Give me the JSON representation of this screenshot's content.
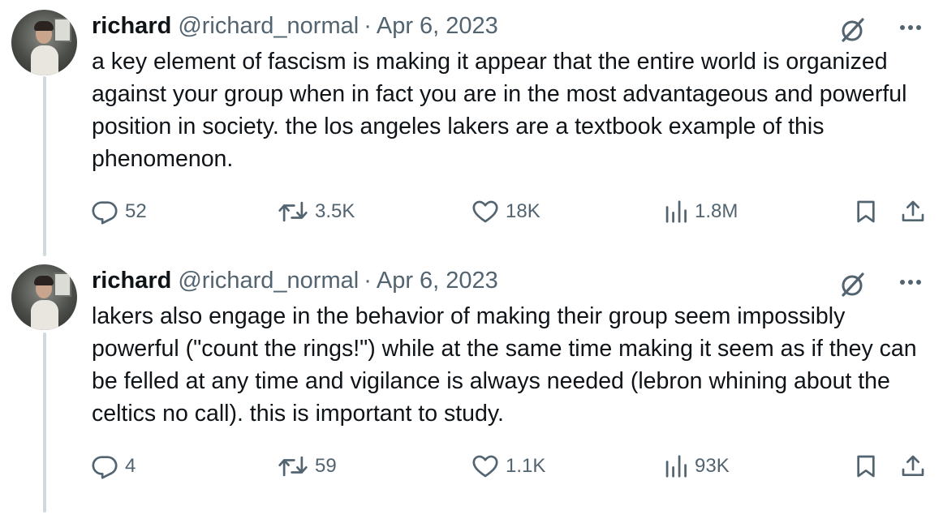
{
  "tweets": [
    {
      "author_name": "richard",
      "handle": "@richard_normal",
      "separator": "·",
      "date": "Apr 6, 2023",
      "text": "a key element of fascism is making it appear that the entire world is organized against your group when in fact you are in the most advantageous and powerful position in society. the los angeles lakers are a textbook example of this phenomenon.",
      "replies": "52",
      "reposts": "3.5K",
      "likes": "18K",
      "views": "1.8M"
    },
    {
      "author_name": "richard",
      "handle": "@richard_normal",
      "separator": "·",
      "date": "Apr 6, 2023",
      "text": "lakers also engage in the behavior of making their group seem impossibly powerful (\"count the rings!\") while at the same time making it seem as if they can be felled at any time and vigilance is always needed (lebron whining about the celtics no call). this is important to study.",
      "replies": "4",
      "reposts": "59",
      "likes": "1.1K",
      "views": "93K"
    }
  ],
  "icons": {
    "reply": "speech-bubble-icon",
    "repost": "repost-arrows-icon",
    "like": "heart-icon",
    "views": "bar-chart-icon",
    "bookmark": "bookmark-icon",
    "share": "share-upload-icon",
    "grok": "grok-slash-circle-icon",
    "more": "ellipsis-icon"
  },
  "colors": {
    "text": "#0f1419",
    "secondary": "#536471",
    "thread_line": "#cfd9de",
    "background": "#ffffff"
  }
}
